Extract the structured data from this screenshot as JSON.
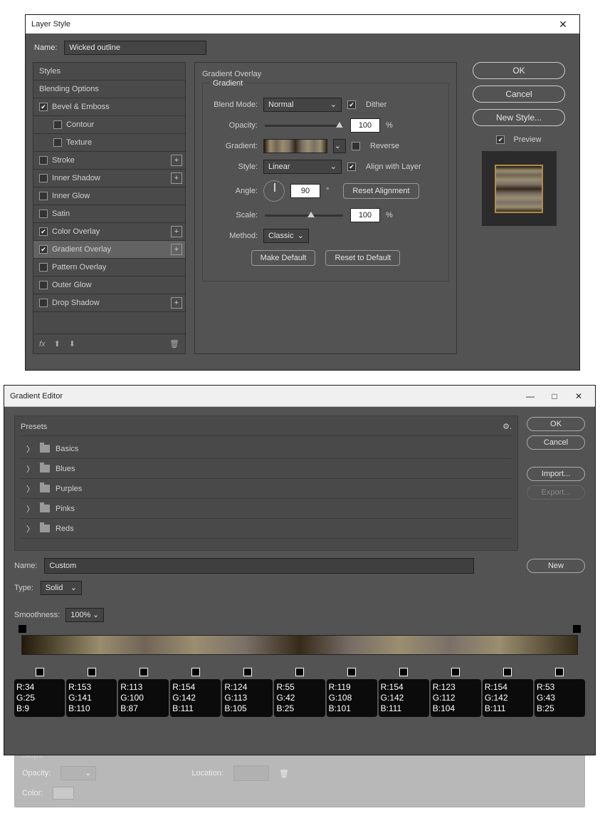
{
  "layer_style": {
    "title": "Layer Style",
    "name_label": "Name:",
    "name_value": "Wicked outline",
    "styles_header": "Styles",
    "blending_options": "Blending Options",
    "effects": {
      "bevel_emboss": "Bevel & Emboss",
      "contour": "Contour",
      "texture": "Texture",
      "stroke": "Stroke",
      "inner_shadow": "Inner Shadow",
      "inner_glow": "Inner Glow",
      "satin": "Satin",
      "color_overlay": "Color Overlay",
      "gradient_overlay": "Gradient Overlay",
      "pattern_overlay": "Pattern Overlay",
      "outer_glow": "Outer Glow",
      "drop_shadow": "Drop Shadow"
    },
    "panel_title": "Gradient Overlay",
    "fieldset_gradient": "Gradient",
    "blend_mode_label": "Blend Mode:",
    "blend_mode_value": "Normal",
    "dither_label": "Dither",
    "opacity_label": "Opacity:",
    "opacity_value": "100",
    "percent": "%",
    "gradient_label": "Gradient:",
    "reverse_label": "Reverse",
    "style_label": "Style:",
    "style_value": "Linear",
    "align_label": "Align with Layer",
    "angle_label": "Angle:",
    "angle_value": "90",
    "degree": "°",
    "reset_alignment": "Reset Alignment",
    "scale_label": "Scale:",
    "scale_value": "100",
    "method_label": "Method:",
    "method_value": "Classic",
    "make_default": "Make Default",
    "reset_default": "Reset to Default",
    "ok": "OK",
    "cancel": "Cancel",
    "new_style": "New Style...",
    "preview_label": "Preview",
    "fx_label": "fx"
  },
  "gradient_editor": {
    "title": "Gradient Editor",
    "presets_label": "Presets",
    "preset_folders": [
      "Basics",
      "Blues",
      "Purples",
      "Pinks",
      "Reds"
    ],
    "name_label": "Name:",
    "name_value": "Custom",
    "type_label": "Type:",
    "type_value": "Solid",
    "smoothness_label": "Smoothness:",
    "smoothness_value": "100%",
    "stops_label": "Stops",
    "opacity_label": "Opacity:",
    "color_label": "Color:",
    "location_label": "Location:",
    "ok": "OK",
    "cancel": "Cancel",
    "import": "Import...",
    "export": "Export...",
    "new": "New",
    "rgb_stops": [
      {
        "r": 34,
        "g": 25,
        "b": 9
      },
      {
        "r": 153,
        "g": 141,
        "b": 110
      },
      {
        "r": 113,
        "g": 100,
        "b": 87
      },
      {
        "r": 154,
        "g": 142,
        "b": 111
      },
      {
        "r": 124,
        "g": 113,
        "b": 105
      },
      {
        "r": 55,
        "g": 42,
        "b": 25
      },
      {
        "r": 119,
        "g": 108,
        "b": 101
      },
      {
        "r": 154,
        "g": 142,
        "b": 111
      },
      {
        "r": 123,
        "g": 112,
        "b": 104
      },
      {
        "r": 154,
        "g": 142,
        "b": 111
      },
      {
        "r": 53,
        "g": 43,
        "b": 25
      }
    ]
  }
}
